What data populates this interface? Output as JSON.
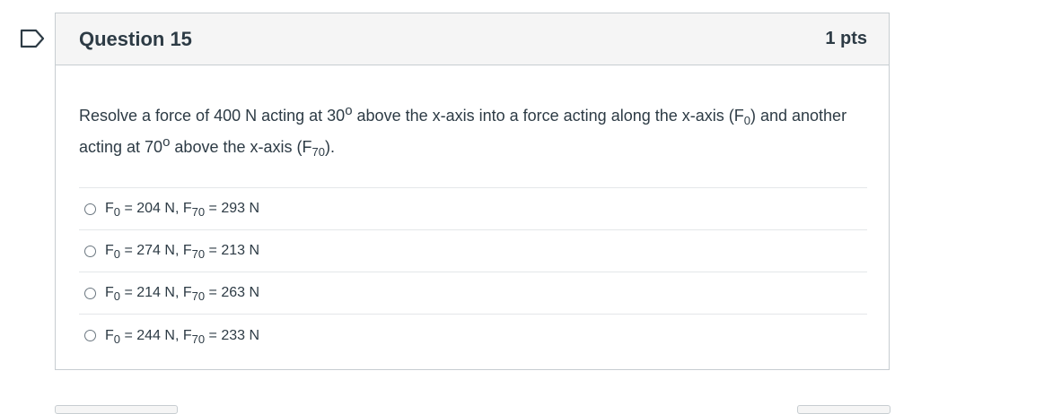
{
  "question": {
    "title": "Question 15",
    "points": "1 pts",
    "text": {
      "part1": "Resolve a force of 400 N acting at 30",
      "deg1": "o",
      "part2": " above the x-axis into a force acting along the x-axis (F",
      "sub1": "0",
      "part3": ") and another acting at 70",
      "deg2": "o",
      "part4": " above the x-axis (F",
      "sub2": "70",
      "part5": ")."
    },
    "answers": [
      {
        "f0_label": "F",
        "f0_sub": "0",
        "f0_val": " = 204 N, F",
        "f70_sub": "70",
        "f70_val": " = 293 N"
      },
      {
        "f0_label": "F",
        "f0_sub": "0",
        "f0_val": " = 274 N, F",
        "f70_sub": "70",
        "f70_val": " = 213 N"
      },
      {
        "f0_label": "F",
        "f0_sub": "0",
        "f0_val": " = 214 N, F",
        "f70_sub": "70",
        "f70_val": " = 263 N"
      },
      {
        "f0_label": "F",
        "f0_sub": "0",
        "f0_val": " = 244 N, F",
        "f70_sub": "70",
        "f70_val": " = 233 N"
      }
    ]
  },
  "icons": {
    "flag": "flag-icon",
    "radio": "radio-button-icon"
  },
  "colors": {
    "flag_border": "#2d3b45",
    "header_bg": "#f5f5f5",
    "border": "#c7cdd1",
    "text": "#2d3b45"
  }
}
